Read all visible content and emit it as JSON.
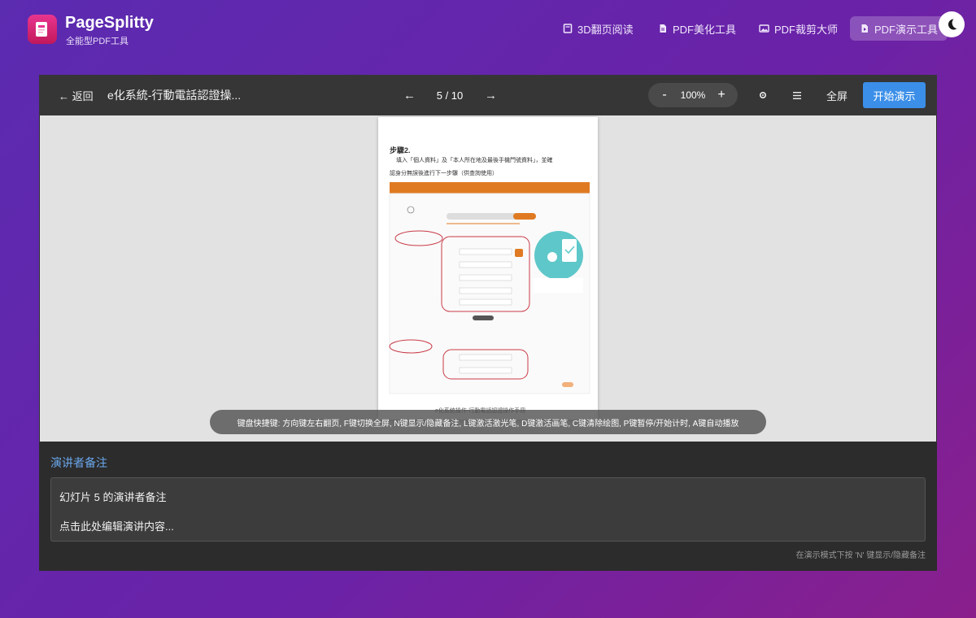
{
  "brand": {
    "name": "PageSplitty",
    "subtitle": "全能型PDF工具"
  },
  "nav": [
    {
      "label": "3D翻页阅读",
      "icon": "book-icon"
    },
    {
      "label": "PDF美化工具",
      "icon": "document-icon"
    },
    {
      "label": "PDF裁剪大师",
      "icon": "image-icon"
    },
    {
      "label": "PDF演示工具",
      "icon": "presentation-icon",
      "active": true
    }
  ],
  "toolbar": {
    "back_label": "← 返回",
    "doc_title": "e化系統-行動電話認證操...",
    "prev_label": "←",
    "page_indicator": "5 / 10",
    "next_label": "→",
    "zoom_out": "-",
    "zoom_level": "100%",
    "zoom_in": "+",
    "settings_icon": "gear-icon",
    "menu_icon": "menu-icon",
    "fullscreen_label": "全屏",
    "start_label": "开始演示"
  },
  "slide": {
    "step_heading": "步驟2.",
    "line1": "填入「個人資料」及「本人所在地及最後手機門號資料」，並確",
    "line2": "認身分無誤後進行下一步驟（供查詢使用）",
    "footer": "e化系統操作-行動電話認證操作手冊",
    "accent_color": "#e07a22",
    "circle_color": "#c93a47",
    "illustration_color": "#5ec7c9"
  },
  "shortcut_hint": "键盘快捷键: 方向键左右翻页, F键切换全屏, N键显示/隐藏备注, L键激活激光笔, D键激活画笔, C键清除绘图, P键暂停/开始计时, A键自动播放",
  "notes": {
    "title": "演讲者备注",
    "line1": "幻灯片 5 的演讲者备注",
    "line2": "点击此处编辑演讲内容...",
    "hint": "在演示模式下按 'N' 键显示/隐藏备注"
  },
  "colors": {
    "accent_blue": "#3b8fe8",
    "notes_title": "#6aa8ee",
    "brand_tile": "#d81b60"
  }
}
